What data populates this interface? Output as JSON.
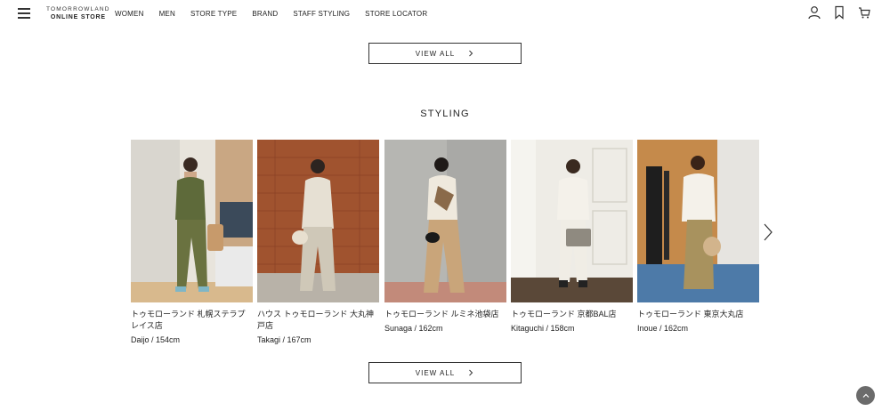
{
  "header": {
    "logo_line1": "TOMORROWLAND",
    "logo_line2": "ONLINE STORE",
    "nav": [
      "WOMEN",
      "MEN",
      "STORE TYPE",
      "BRAND",
      "STAFF STYLING",
      "STORE LOCATOR"
    ],
    "icons": [
      "menu-icon",
      "user-icon",
      "bookmark-icon",
      "cart-icon"
    ]
  },
  "top_section": {
    "view_all_label": "VIEW ALL"
  },
  "styling": {
    "title": "STYLING",
    "cards": [
      {
        "store": "トゥモローランド 札幌ステラプレイス店",
        "staff": "Daijo / 154cm"
      },
      {
        "store": "ハウス トゥモローランド 大丸神戸店",
        "staff": "Takagi / 167cm"
      },
      {
        "store": "トゥモローランド ルミネ池袋店",
        "staff": "Sunaga / 162cm"
      },
      {
        "store": "トゥモローランド 京都BAL店",
        "staff": "Kitaguchi / 158cm"
      },
      {
        "store": "トゥモローランド 東京大丸店",
        "staff": "Inoue / 162cm"
      }
    ],
    "view_all_label": "VIEW ALL"
  },
  "icons": {
    "next": "chevron-right-icon",
    "back_to_top": "arrow-up-icon"
  }
}
